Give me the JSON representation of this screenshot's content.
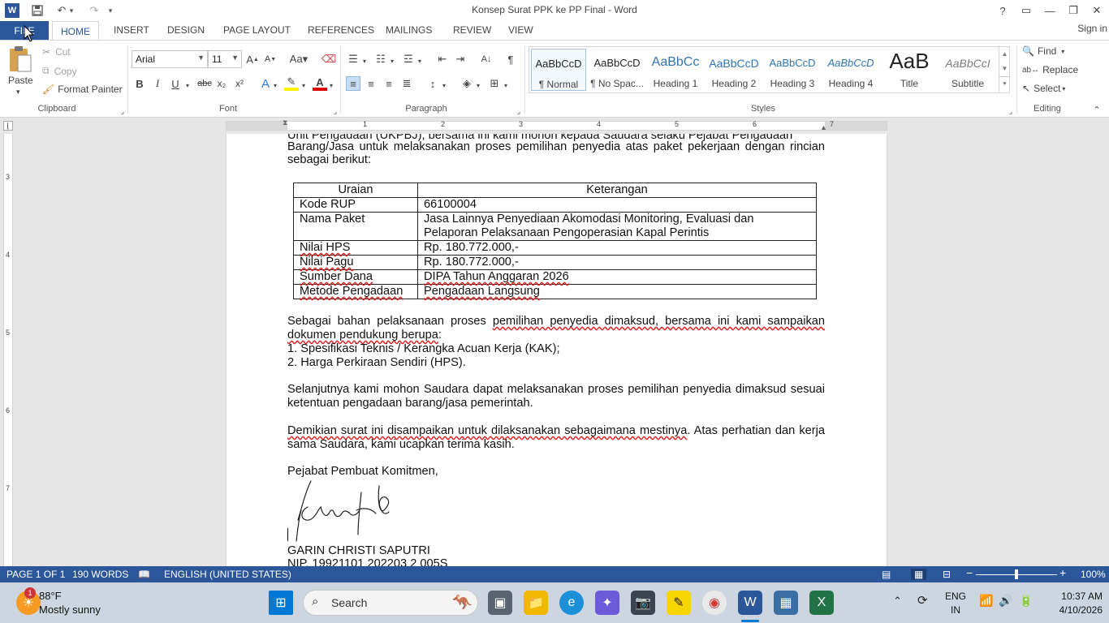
{
  "window": {
    "title": "Konsep Surat PPK ke PP Final - Word"
  },
  "quick_access": {
    "word": "W",
    "save": "💾",
    "undo": "↶",
    "redo": "↷",
    "more": "▾"
  },
  "window_controls": {
    "help": "?",
    "ribbon_display": "▭",
    "minimize": "—",
    "restore": "❐",
    "close": "✕"
  },
  "tabs": [
    "FILE",
    "HOME",
    "INSERT",
    "DESIGN",
    "PAGE LAYOUT",
    "REFERENCES",
    "MAILINGS",
    "REVIEW",
    "VIEW"
  ],
  "signin": "Sign in",
  "clipboard": {
    "paste": "Paste",
    "cut": "Cut",
    "copy": "Copy",
    "format_painter": "Format Painter",
    "label": "Clipboard"
  },
  "font": {
    "name": "Arial",
    "size": "11",
    "label": "Font"
  },
  "paragraph": {
    "label": "Paragraph"
  },
  "styles": {
    "label": "Styles",
    "items": [
      {
        "preview": "AaBbCcD",
        "name": "¶ Normal"
      },
      {
        "preview": "AaBbCcD",
        "name": "¶ No Spac..."
      },
      {
        "preview": "AaBbCc",
        "name": "Heading 1"
      },
      {
        "preview": "AaBbCcD",
        "name": "Heading 2"
      },
      {
        "preview": "AaBbCcD",
        "name": "Heading 3"
      },
      {
        "preview": "AaBbCcD",
        "name": "Heading 4"
      },
      {
        "preview": "AaB",
        "name": "Title"
      },
      {
        "preview": "AaBbCcI",
        "name": "Subtitle"
      }
    ]
  },
  "editing": {
    "find": "Find",
    "replace": "Replace",
    "select": "Select",
    "label": "Editing"
  },
  "ruler": {
    "h": [
      "1",
      "2",
      "3",
      "4",
      "5",
      "6",
      "7"
    ],
    "v": [
      "3",
      "4",
      "5",
      "6",
      "7"
    ]
  },
  "document": {
    "intro_top": "Unit Pengadaan (UKPBJ), bersama ini kami mohon kepada Saudara selaku Pejabat Pengadaan",
    "intro": "Barang/Jasa untuk melaksanakan proses pemilihan penyedia atas paket pekerjaan dengan rincian sebagai berikut:",
    "table_headers": [
      "Uraian",
      "Keterangan"
    ],
    "table_rows": [
      [
        "Kode RUP",
        "66100004"
      ],
      [
        "Nama Paket",
        "Jasa Lainnya Penyediaan Akomodasi Monitoring, Evaluasi dan Pelaporan Pelaksanaan Pengoperasian Kapal Perintis"
      ],
      [
        "Nilai HPS",
        "Rp. 180.772.000,-"
      ],
      [
        "Nilai Pagu",
        "Rp. 180.772.000,-"
      ],
      [
        "Sumber Dana",
        "DIPA Tahun Anggaran 2026"
      ],
      [
        "Metode Pengadaan",
        "Pengadaan Langsung"
      ]
    ],
    "para2_a": "Sebagai bahan pelaksanaan proses ",
    "para2_b": "pemilihan penyedia dimaksud, bersama ini kami sampaikan dokumen pendukung berupa",
    "para2_c": ":",
    "list1": "1.  Spesifikasi Teknis / Kerangka Acuan Kerja (KAK);",
    "list2": "2.  Harga Perkiraan Sendiri (HPS).",
    "para3": "Selanjutnya kami mohon Saudara dapat melaksanakan proses pemilihan penyedia dimaksud sesuai ketentuan pengadaan barang/jasa pemerintah.",
    "para4_a": "Demikian surat ini disampaikan untuk dilaksanakan sebagaimana mestinya",
    "para4_b": ". Atas perhatian dan kerja sama Saudara, kami ucapkan terima kasih.",
    "closing": "Pejabat Pembuat Komitmen,",
    "signer": "GARIN CHRISTI SAPUTRI",
    "nip": "NIP.  19921101 202203 2 005S"
  },
  "status": {
    "page": "PAGE 1 OF 1",
    "words": "190 WORDS",
    "language": "ENGLISH (UNITED STATES)",
    "zoom": "100%"
  },
  "taskbar": {
    "weather_temp": "88°F",
    "weather_desc": "Mostly sunny",
    "weather_badge": "1",
    "search": "Search",
    "lang1": "ENG",
    "lang2": "IN",
    "time": "10:37 AM",
    "date": "4/10/2026"
  },
  "colors": {
    "brand": "#2b579a",
    "spell": "#e02020"
  }
}
